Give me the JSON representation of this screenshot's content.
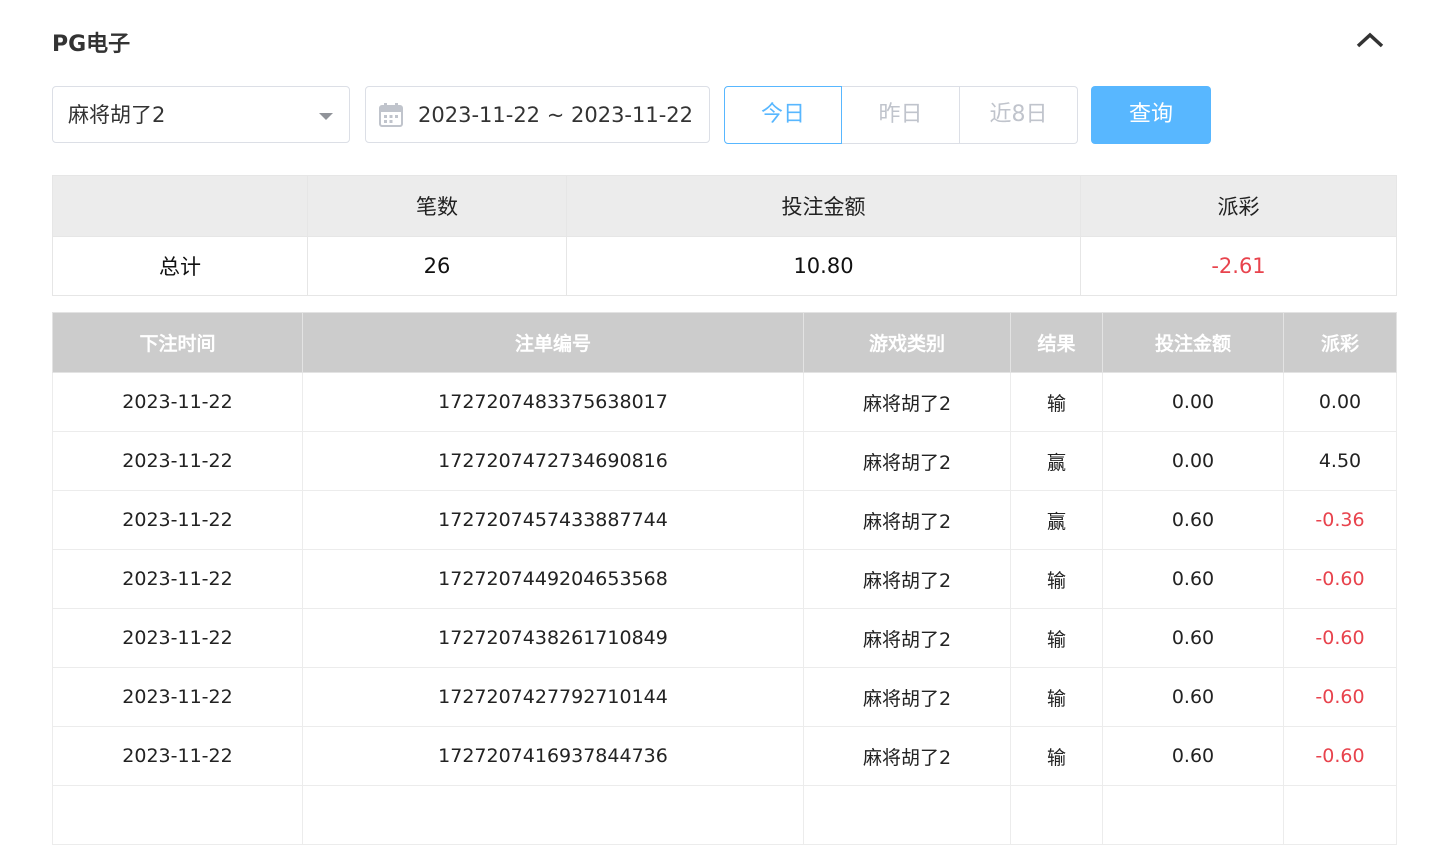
{
  "header": {
    "title": "PG电子"
  },
  "filters": {
    "game_select": "麻将胡了2",
    "date_range": "2023-11-22 ~ 2023-11-22",
    "range_buttons": [
      "今日",
      "昨日",
      "近8日"
    ],
    "query_label": "查询"
  },
  "summary": {
    "headers": [
      "",
      "笔数",
      "投注金额",
      "派彩"
    ],
    "row": {
      "label": "总计",
      "count": "26",
      "bet": "10.80",
      "payout": "-2.61"
    }
  },
  "detail": {
    "headers": [
      "下注时间",
      "注单编号",
      "游戏类别",
      "结果",
      "投注金额",
      "派彩"
    ],
    "rows": [
      [
        "2023-11-22",
        "1727207483375638017",
        "麻将胡了2",
        "输",
        "0.00",
        "0.00"
      ],
      [
        "2023-11-22",
        "1727207472734690816",
        "麻将胡了2",
        "赢",
        "0.00",
        "4.50"
      ],
      [
        "2023-11-22",
        "1727207457433887744",
        "麻将胡了2",
        "赢",
        "0.60",
        "-0.36"
      ],
      [
        "2023-11-22",
        "1727207449204653568",
        "麻将胡了2",
        "输",
        "0.60",
        "-0.60"
      ],
      [
        "2023-11-22",
        "1727207438261710849",
        "麻将胡了2",
        "输",
        "0.60",
        "-0.60"
      ],
      [
        "2023-11-22",
        "1727207427792710144",
        "麻将胡了2",
        "输",
        "0.60",
        "-0.60"
      ],
      [
        "2023-11-22",
        "1727207416937844736",
        "麻将胡了2",
        "输",
        "0.60",
        "-0.60"
      ]
    ]
  },
  "colors": {
    "accent": "#58b7ff",
    "negative": "#e8434d",
    "header_bg": "#cccccc"
  }
}
